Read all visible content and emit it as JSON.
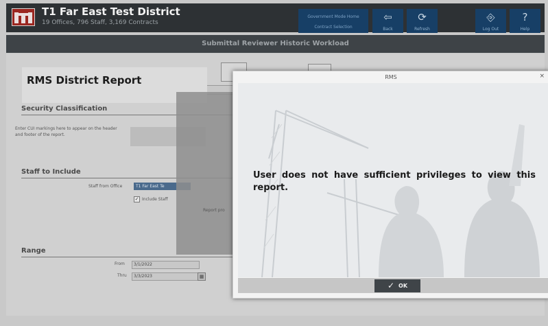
{
  "header": {
    "title": "T1 Far East Test District",
    "subtitle": "19 Offices, 796 Staff, 3,169 Contracts",
    "gov_line1": "Government Mode Home",
    "gov_line2": "Contract Selection",
    "buttons": [
      {
        "label": "Back",
        "icon": "back-arrow-icon"
      },
      {
        "label": "Refresh",
        "icon": "refresh-icon"
      },
      {
        "label": "Log Out",
        "icon": "logout-icon"
      },
      {
        "label": "Help",
        "icon": "help-icon"
      }
    ]
  },
  "subbar": {
    "title": "Submittal Reviewer Historic Workload"
  },
  "report": {
    "title": "RMS District Report",
    "security_heading": "Security Classification",
    "cui_help": "Enter CUI markings here to appear on the header and footer of the report.",
    "staff_heading": "Staff to Include",
    "staff_from_label": "Staff from Office",
    "staff_from_value": "T1 Far East Te",
    "include_label": "Include Staff",
    "range_heading": "Range",
    "from_label": "From",
    "from_value": "3/1/2022",
    "thru_label": "Thru",
    "thru_value": "3/3/2023",
    "behind_text": "Report pro"
  },
  "modal": {
    "title": "RMS",
    "message": "User does not have sufficient privileges to view this report.",
    "ok_label": "OK"
  },
  "colors": {
    "header_bg": "#2d3134",
    "nav_button": "#173f66",
    "logo_red": "#9b2620",
    "ok_button": "#3f4448"
  }
}
